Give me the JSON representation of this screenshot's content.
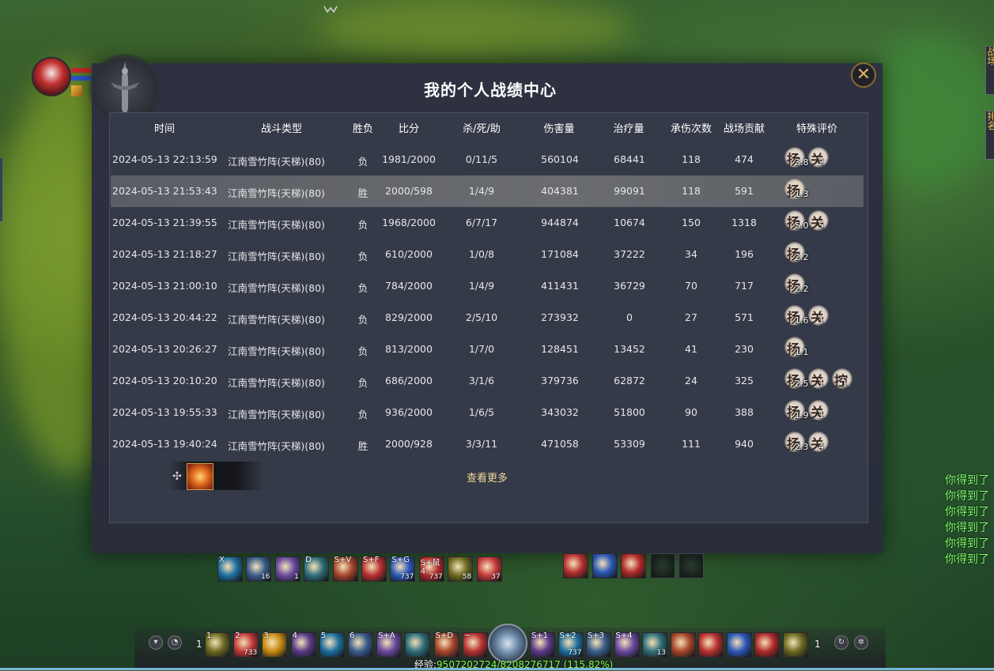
{
  "dialog": {
    "title": "我的个人战绩中心",
    "close_label": "✕",
    "more_link": "查看更多"
  },
  "table": {
    "headers": {
      "time": "时间",
      "type": "战斗类型",
      "result": "胜负",
      "score": "比分",
      "kda": "杀/死/助",
      "damage": "伤害量",
      "heal": "治疗量",
      "hits": "承伤次数",
      "contrib": "战场贡献",
      "rating": "特殊评价"
    },
    "rows": [
      {
        "time": "2024-05-13 22:13:59",
        "type": "江南雪竹阵(天梯)(80)",
        "result": "负",
        "score": "1981/2000",
        "kda": "0/11/5",
        "damage": "560104",
        "heal": "68441",
        "hits": "118",
        "contrib": "474",
        "badges": [
          {
            "glyph": "扬",
            "value": "3.8"
          },
          {
            "glyph": "关",
            "value": "2"
          }
        ]
      },
      {
        "time": "2024-05-13 21:53:43",
        "type": "江南雪竹阵(天梯)(80)",
        "result": "胜",
        "score": "2000/598",
        "kda": "1/4/9",
        "damage": "404381",
        "heal": "99091",
        "hits": "118",
        "contrib": "591",
        "badges": [
          {
            "glyph": "扬",
            "value": "1.3"
          }
        ]
      },
      {
        "time": "2024-05-13 21:39:55",
        "type": "江南雪竹阵(天梯)(80)",
        "result": "负",
        "score": "1968/2000",
        "kda": "6/7/17",
        "damage": "944874",
        "heal": "10674",
        "hits": "150",
        "contrib": "1318",
        "badges": [
          {
            "glyph": "扬",
            "value": "5.0"
          },
          {
            "glyph": "关",
            "value": "5"
          }
        ]
      },
      {
        "time": "2024-05-13 21:18:27",
        "type": "江南雪竹阵(天梯)(80)",
        "result": "负",
        "score": "610/2000",
        "kda": "1/0/8",
        "damage": "171084",
        "heal": "37222",
        "hits": "34",
        "contrib": "196",
        "badges": [
          {
            "glyph": "扬",
            "value": "2.2"
          }
        ]
      },
      {
        "time": "2024-05-13 21:00:10",
        "type": "江南雪竹阵(天梯)(80)",
        "result": "负",
        "score": "784/2000",
        "kda": "1/4/9",
        "damage": "411431",
        "heal": "36729",
        "hits": "70",
        "contrib": "717",
        "badges": [
          {
            "glyph": "扬",
            "value": "2.2"
          }
        ]
      },
      {
        "time": "2024-05-13 20:44:22",
        "type": "江南雪竹阵(天梯)(80)",
        "result": "负",
        "score": "829/2000",
        "kda": "2/5/10",
        "damage": "273932",
        "heal": "0",
        "hits": "27",
        "contrib": "571",
        "badges": [
          {
            "glyph": "扬",
            "value": "1.6"
          },
          {
            "glyph": "关",
            "value": "1"
          }
        ]
      },
      {
        "time": "2024-05-13 20:26:27",
        "type": "江南雪竹阵(天梯)(80)",
        "result": "负",
        "score": "813/2000",
        "kda": "1/7/0",
        "damage": "128451",
        "heal": "13452",
        "hits": "41",
        "contrib": "230",
        "badges": [
          {
            "glyph": "扬",
            "value": "1.1"
          }
        ]
      },
      {
        "time": "2024-05-13 20:10:20",
        "type": "江南雪竹阵(天梯)(80)",
        "result": "负",
        "score": "686/2000",
        "kda": "3/1/6",
        "damage": "379736",
        "heal": "62872",
        "hits": "24",
        "contrib": "325",
        "badges": [
          {
            "glyph": "扬",
            "value": "2.5"
          },
          {
            "glyph": "关",
            "value": "1"
          },
          {
            "glyph": "控",
            "value": "1"
          }
        ]
      },
      {
        "time": "2024-05-13 19:55:33",
        "type": "江南雪竹阵(天梯)(80)",
        "result": "负",
        "score": "936/2000",
        "kda": "1/6/5",
        "damage": "343032",
        "heal": "51800",
        "hits": "90",
        "contrib": "388",
        "badges": [
          {
            "glyph": "扬",
            "value": "1.9"
          },
          {
            "glyph": "关",
            "value": "1"
          }
        ]
      },
      {
        "time": "2024-05-13 19:40:24",
        "type": "江南雪竹阵(天梯)(80)",
        "result": "胜",
        "score": "2000/928",
        "kda": "3/3/11",
        "damage": "471058",
        "heal": "53309",
        "hits": "111",
        "contrib": "940",
        "badges": [
          {
            "glyph": "扬",
            "value": "2.3"
          },
          {
            "glyph": "关",
            "value": "4"
          }
        ]
      }
    ]
  },
  "hud": {
    "exp_label": "经验:",
    "exp_value": "9507202724/8208276717 (115.82%)",
    "chat_lines": [
      "你得到了",
      "你得到了",
      "你得到了",
      "你得到了",
      "你得到了",
      "你得到了"
    ],
    "side_tabs": [
      "战场",
      "排名"
    ],
    "bar_left_num": "1",
    "bar_right_num": "1",
    "skills_top": [
      {
        "key": "X",
        "count": ""
      },
      {
        "key": "",
        "count": "16"
      },
      {
        "key": "",
        "count": "1"
      },
      {
        "key": "D",
        "count": ""
      },
      {
        "key": "S+V",
        "count": ""
      },
      {
        "key": "S+F",
        "count": ""
      },
      {
        "key": "S+G",
        "count": "737"
      },
      {
        "key": "S+鼠4",
        "count": "737"
      },
      {
        "key": "",
        "count": "58"
      },
      {
        "key": "",
        "count": "37"
      }
    ],
    "skills_top_right": [
      {
        "key": "",
        "count": ""
      },
      {
        "key": "",
        "count": ""
      },
      {
        "key": "",
        "count": ""
      },
      {
        "key": "",
        "count": ""
      },
      {
        "key": "",
        "count": ""
      }
    ],
    "skills_bottom_left": [
      {
        "key": "1",
        "count": ""
      },
      {
        "key": "2",
        "count": "733"
      },
      {
        "key": "3",
        "count": ""
      },
      {
        "key": "4",
        "count": ""
      },
      {
        "key": "5",
        "count": ""
      },
      {
        "key": "6",
        "count": ""
      },
      {
        "key": "S+A",
        "count": ""
      },
      {
        "key": "",
        "count": ""
      },
      {
        "key": "S+D",
        "count": ""
      },
      {
        "key": "~",
        "count": ""
      }
    ],
    "skills_bottom_right": [
      {
        "key": "S+1",
        "count": ""
      },
      {
        "key": "S+2",
        "count": "737"
      },
      {
        "key": "S+3",
        "count": ""
      },
      {
        "key": "S+4",
        "count": ""
      },
      {
        "key": "",
        "count": "13"
      },
      {
        "key": "",
        "count": ""
      },
      {
        "key": "",
        "count": ""
      },
      {
        "key": "",
        "count": ""
      },
      {
        "key": "",
        "count": ""
      },
      {
        "key": "",
        "count": ""
      }
    ]
  }
}
